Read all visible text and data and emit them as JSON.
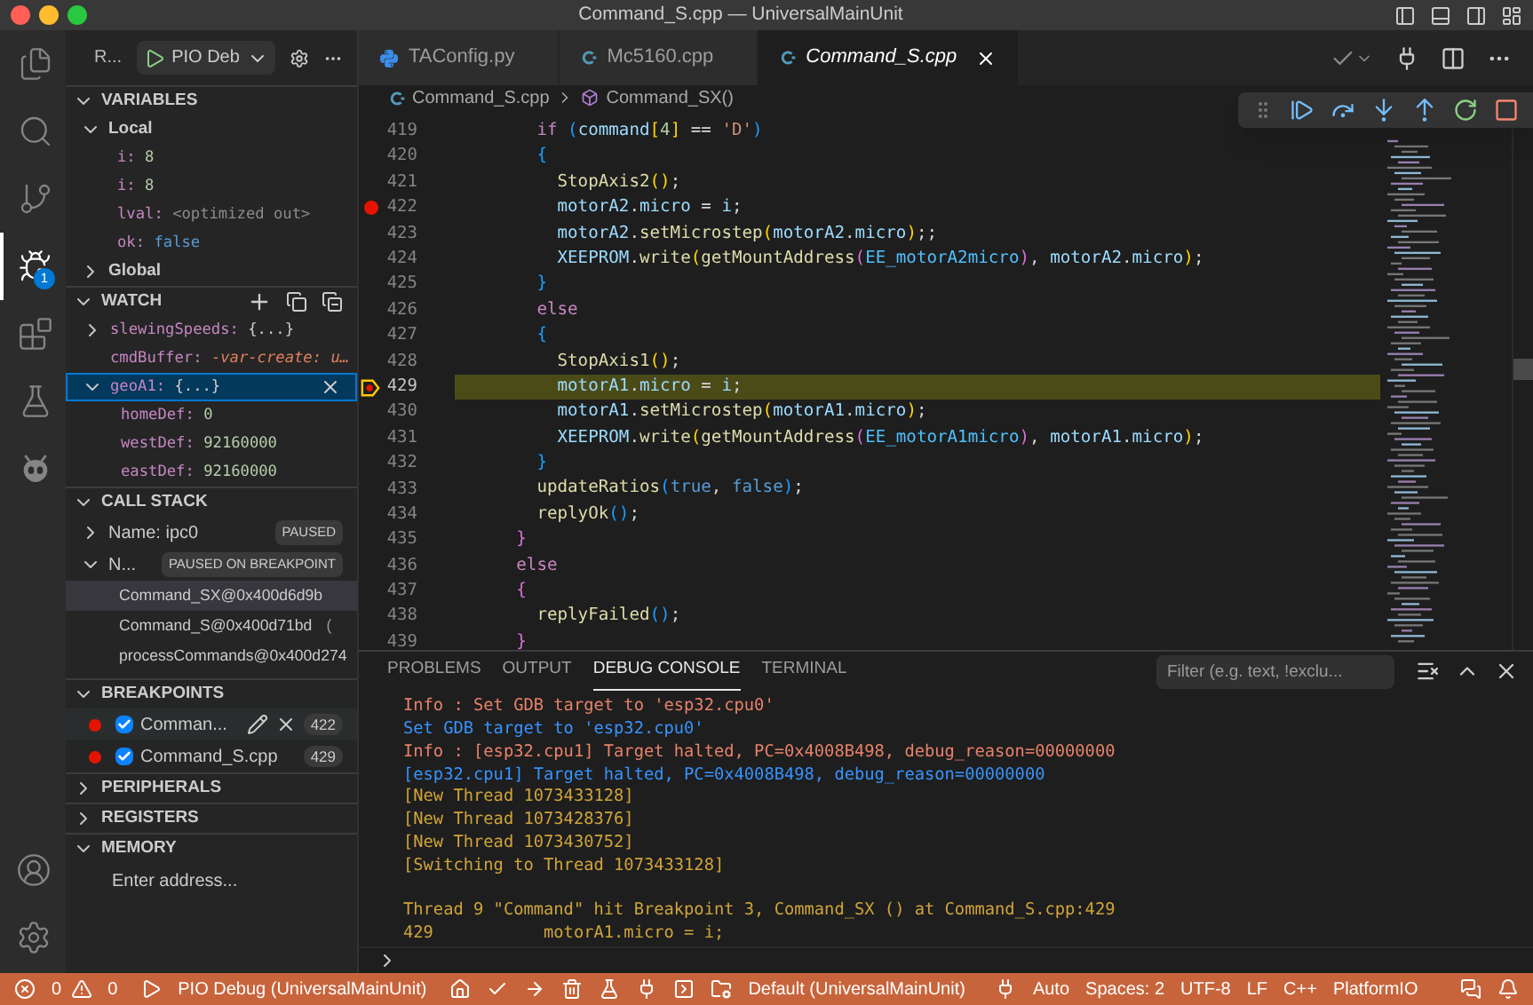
{
  "window": {
    "title": "Command_S.cpp — UniversalMainUnit"
  },
  "activity_bar": {
    "items": [
      {
        "selected": false
      },
      {
        "selected": false
      },
      {
        "selected": false
      },
      {
        "selected": true,
        "badge": "1"
      },
      {
        "selected": false
      },
      {
        "selected": false
      },
      {
        "selected": false
      }
    ]
  },
  "sidebar": {
    "title": "R...",
    "launch_config": "PIO Deb",
    "variables": {
      "title": "VARIABLES",
      "expanded": true,
      "scopes": [
        {
          "label": "Local",
          "expanded": true,
          "children": [
            {
              "name": "i:",
              "value": "8",
              "kind": "number"
            },
            {
              "name": "i:",
              "value": "8",
              "kind": "number"
            },
            {
              "name": "lval:",
              "value": "<optimized out>",
              "kind": "unavailable"
            },
            {
              "name": "ok:",
              "value": "false",
              "kind": "boolean"
            }
          ]
        },
        {
          "label": "Global",
          "expanded": false
        }
      ]
    },
    "watch": {
      "title": "WATCH",
      "expanded": true,
      "items": [
        {
          "name": "slewingSpeeds:",
          "value": "{...}",
          "kind": "object",
          "expanded": false,
          "selected": false
        },
        {
          "name": "cmdBuffer:",
          "value": "-var-create: u…",
          "kind": "error",
          "selected": false
        },
        {
          "name": "geoA1:",
          "value": "{...}",
          "kind": "object",
          "expanded": true,
          "selected": true,
          "children": [
            {
              "name": "homeDef:",
              "value": "0",
              "kind": "number"
            },
            {
              "name": "westDef:",
              "value": "92160000",
              "kind": "number"
            },
            {
              "name": "eastDef:",
              "value": "92160000",
              "kind": "number"
            }
          ]
        }
      ]
    },
    "call_stack": {
      "title": "CALL STACK",
      "expanded": true,
      "threads": [
        {
          "name": "Name: ipc0",
          "status": "PAUSED",
          "expanded": false
        },
        {
          "name": "N...",
          "status": "PAUSED ON BREAKPOINT",
          "expanded": true,
          "frames": [
            {
              "label": "Command_SX@0x400d6d9b",
              "selected": true
            },
            {
              "label": "Command_S@0x400d71bd",
              "source": "(",
              "selected": false
            },
            {
              "label": "processCommands@0x400d274",
              "selected": false
            }
          ]
        }
      ]
    },
    "breakpoints": {
      "title": "BREAKPOINTS",
      "expanded": true,
      "items": [
        {
          "file": "Comman...",
          "line": "422",
          "enabled": true,
          "selected": true
        },
        {
          "file": "Command_S.cpp",
          "line": "429",
          "enabled": true,
          "selected": false
        }
      ]
    },
    "peripherals": {
      "title": "PERIPHERALS",
      "expanded": false
    },
    "registers": {
      "title": "REGISTERS",
      "expanded": false
    },
    "memory": {
      "title": "MEMORY",
      "expanded": true,
      "placeholder": "Enter address..."
    }
  },
  "editor": {
    "tabs": [
      {
        "label": "TAConfig.py",
        "kind": "python",
        "selected": false,
        "preview": false
      },
      {
        "label": "Mc5160.cpp",
        "kind": "cpp",
        "selected": false,
        "preview": false
      },
      {
        "label": "Command_S.cpp",
        "kind": "cpp",
        "selected": true,
        "preview": true
      }
    ],
    "breadcrumb": {
      "file": "Command_S.cpp",
      "symbol": "Command_SX()"
    },
    "lines": [
      {
        "number": "419",
        "breakpoint": false,
        "current": false,
        "tokens": [
          {
            "text": "        if ",
            "kind": "kw"
          },
          {
            "text": "(",
            "kind": "b3"
          },
          {
            "text": "command",
            "kind": "var"
          },
          {
            "text": "[",
            "kind": "b1"
          },
          {
            "text": "4",
            "kind": "num"
          },
          {
            "text": "]",
            "kind": "b1"
          },
          {
            "text": " == ",
            "kind": "op"
          },
          {
            "text": "'D'",
            "kind": "str"
          },
          {
            "text": ")",
            "kind": "b3"
          }
        ]
      },
      {
        "number": "420",
        "breakpoint": false,
        "current": false,
        "tokens": [
          {
            "text": "        {",
            "kind": "b3"
          }
        ]
      },
      {
        "number": "421",
        "breakpoint": false,
        "current": false,
        "tokens": [
          {
            "text": "          StopAxis2",
            "kind": "fn"
          },
          {
            "text": "()",
            "kind": "b1"
          },
          {
            "text": ";",
            "kind": "op"
          }
        ]
      },
      {
        "number": "422",
        "breakpoint": true,
        "current": false,
        "tokens": [
          {
            "text": "          motorA2",
            "kind": "var"
          },
          {
            "text": ".",
            "kind": "op"
          },
          {
            "text": "micro",
            "kind": "var"
          },
          {
            "text": " = ",
            "kind": "op"
          },
          {
            "text": "i",
            "kind": "var"
          },
          {
            "text": ";",
            "kind": "op"
          }
        ]
      },
      {
        "number": "423",
        "breakpoint": false,
        "current": false,
        "tokens": [
          {
            "text": "          motorA2",
            "kind": "var"
          },
          {
            "text": ".",
            "kind": "op"
          },
          {
            "text": "setMicrostep",
            "kind": "fn"
          },
          {
            "text": "(",
            "kind": "b1"
          },
          {
            "text": "motorA2",
            "kind": "var"
          },
          {
            "text": ".",
            "kind": "op"
          },
          {
            "text": "micro",
            "kind": "var"
          },
          {
            "text": ")",
            "kind": "b1"
          },
          {
            "text": ";;",
            "kind": "op"
          }
        ]
      },
      {
        "number": "424",
        "breakpoint": false,
        "current": false,
        "tokens": [
          {
            "text": "          XEEPROM",
            "kind": "var"
          },
          {
            "text": ".",
            "kind": "op"
          },
          {
            "text": "write",
            "kind": "fn"
          },
          {
            "text": "(",
            "kind": "b1"
          },
          {
            "text": "getMountAddress",
            "kind": "fn"
          },
          {
            "text": "(",
            "kind": "b2"
          },
          {
            "text": "EE_motorA2micro",
            "kind": "const"
          },
          {
            "text": ")",
            "kind": "b2"
          },
          {
            "text": ", ",
            "kind": "op"
          },
          {
            "text": "motorA2",
            "kind": "var"
          },
          {
            "text": ".",
            "kind": "op"
          },
          {
            "text": "micro",
            "kind": "var"
          },
          {
            "text": ")",
            "kind": "b1"
          },
          {
            "text": ";",
            "kind": "op"
          }
        ]
      },
      {
        "number": "425",
        "breakpoint": false,
        "current": false,
        "tokens": [
          {
            "text": "        }",
            "kind": "b3"
          }
        ]
      },
      {
        "number": "426",
        "breakpoint": false,
        "current": false,
        "tokens": [
          {
            "text": "        else",
            "kind": "kw"
          }
        ]
      },
      {
        "number": "427",
        "breakpoint": false,
        "current": false,
        "tokens": [
          {
            "text": "        {",
            "kind": "b3"
          }
        ]
      },
      {
        "number": "428",
        "breakpoint": false,
        "current": false,
        "tokens": [
          {
            "text": "          StopAxis1",
            "kind": "fn"
          },
          {
            "text": "()",
            "kind": "b1"
          },
          {
            "text": ";",
            "kind": "op"
          }
        ]
      },
      {
        "number": "429",
        "breakpoint": true,
        "current": true,
        "tokens": [
          {
            "text": "          motorA1",
            "kind": "var"
          },
          {
            "text": ".",
            "kind": "op"
          },
          {
            "text": "micro",
            "kind": "var"
          },
          {
            "text": " = ",
            "kind": "op"
          },
          {
            "text": "i",
            "kind": "var"
          },
          {
            "text": ";",
            "kind": "op"
          }
        ]
      },
      {
        "number": "430",
        "breakpoint": false,
        "current": false,
        "tokens": [
          {
            "text": "          motorA1",
            "kind": "var"
          },
          {
            "text": ".",
            "kind": "op"
          },
          {
            "text": "setMicrostep",
            "kind": "fn"
          },
          {
            "text": "(",
            "kind": "b1"
          },
          {
            "text": "motorA1",
            "kind": "var"
          },
          {
            "text": ".",
            "kind": "op"
          },
          {
            "text": "micro",
            "kind": "var"
          },
          {
            "text": ")",
            "kind": "b1"
          },
          {
            "text": ";",
            "kind": "op"
          }
        ]
      },
      {
        "number": "431",
        "breakpoint": false,
        "current": false,
        "tokens": [
          {
            "text": "          XEEPROM",
            "kind": "var"
          },
          {
            "text": ".",
            "kind": "op"
          },
          {
            "text": "write",
            "kind": "fn"
          },
          {
            "text": "(",
            "kind": "b1"
          },
          {
            "text": "getMountAddress",
            "kind": "fn"
          },
          {
            "text": "(",
            "kind": "b2"
          },
          {
            "text": "EE_motorA1micro",
            "kind": "const"
          },
          {
            "text": ")",
            "kind": "b2"
          },
          {
            "text": ", ",
            "kind": "op"
          },
          {
            "text": "motorA1",
            "kind": "var"
          },
          {
            "text": ".",
            "kind": "op"
          },
          {
            "text": "micro",
            "kind": "var"
          },
          {
            "text": ")",
            "kind": "b1"
          },
          {
            "text": ";",
            "kind": "op"
          }
        ]
      },
      {
        "number": "432",
        "breakpoint": false,
        "current": false,
        "tokens": [
          {
            "text": "        }",
            "kind": "b3"
          }
        ]
      },
      {
        "number": "433",
        "breakpoint": false,
        "current": false,
        "tokens": [
          {
            "text": "        updateRatios",
            "kind": "fn"
          },
          {
            "text": "(",
            "kind": "b3"
          },
          {
            "text": "true",
            "kind": "bool"
          },
          {
            "text": ", ",
            "kind": "op"
          },
          {
            "text": "false",
            "kind": "bool"
          },
          {
            "text": ")",
            "kind": "b3"
          },
          {
            "text": ";",
            "kind": "op"
          }
        ]
      },
      {
        "number": "434",
        "breakpoint": false,
        "current": false,
        "tokens": [
          {
            "text": "        replyOk",
            "kind": "fn"
          },
          {
            "text": "()",
            "kind": "b3"
          },
          {
            "text": ";",
            "kind": "op"
          }
        ]
      },
      {
        "number": "435",
        "breakpoint": false,
        "current": false,
        "tokens": [
          {
            "text": "      }",
            "kind": "b2"
          }
        ]
      },
      {
        "number": "436",
        "breakpoint": false,
        "current": false,
        "tokens": [
          {
            "text": "      else",
            "kind": "kw"
          }
        ]
      },
      {
        "number": "437",
        "breakpoint": false,
        "current": false,
        "tokens": [
          {
            "text": "      {",
            "kind": "b2"
          }
        ]
      },
      {
        "number": "438",
        "breakpoint": false,
        "current": false,
        "tokens": [
          {
            "text": "        replyFailed",
            "kind": "fn"
          },
          {
            "text": "()",
            "kind": "b3"
          },
          {
            "text": ";",
            "kind": "op"
          }
        ]
      },
      {
        "number": "439",
        "breakpoint": false,
        "current": false,
        "tokens": [
          {
            "text": "      }",
            "kind": "b2"
          }
        ]
      }
    ]
  },
  "panel": {
    "tabs": [
      {
        "label": "PROBLEMS",
        "selected": false
      },
      {
        "label": "OUTPUT",
        "selected": false
      },
      {
        "label": "DEBUG CONSOLE",
        "selected": true
      },
      {
        "label": "TERMINAL",
        "selected": false
      }
    ],
    "filter": {
      "placeholder": "Filter (e.g. text, !exclu..."
    },
    "console": [
      {
        "text": "Info : Set GDB target to 'esp32.cpu0'",
        "kind": "info"
      },
      {
        "text": "Set GDB target to 'esp32.cpu0'",
        "kind": "gdb"
      },
      {
        "text": "Info : [esp32.cpu1] Target halted, PC=0x4008B498, debug_reason=00000000",
        "kind": "info"
      },
      {
        "text": "[esp32.cpu1] Target halted, PC=0x4008B498, debug_reason=00000000",
        "kind": "gdb"
      },
      {
        "text": "[New Thread 1073433128]",
        "kind": "log"
      },
      {
        "text": "[New Thread 1073428376]",
        "kind": "log"
      },
      {
        "text": "[New Thread 1073430752]",
        "kind": "log"
      },
      {
        "text": "[Switching to Thread 1073433128]",
        "kind": "log"
      },
      {
        "kind": "blank"
      },
      {
        "text": "Thread 9 \"Command\" hit Breakpoint 3, Command_SX () at Command_S.cpp:429",
        "kind": "log"
      },
      {
        "text": "429           motorA1.micro = i;",
        "kind": "log"
      }
    ]
  },
  "status_bar": {
    "errors": "0",
    "warnings": "0",
    "debug_target": "PIO Debug (UniversalMainUnit)",
    "environment": "Default (UniversalMainUnit)",
    "port": "Auto",
    "right": [
      "Spaces: 2",
      "UTF-8",
      "LF",
      "C++",
      "PlatformIO"
    ]
  }
}
